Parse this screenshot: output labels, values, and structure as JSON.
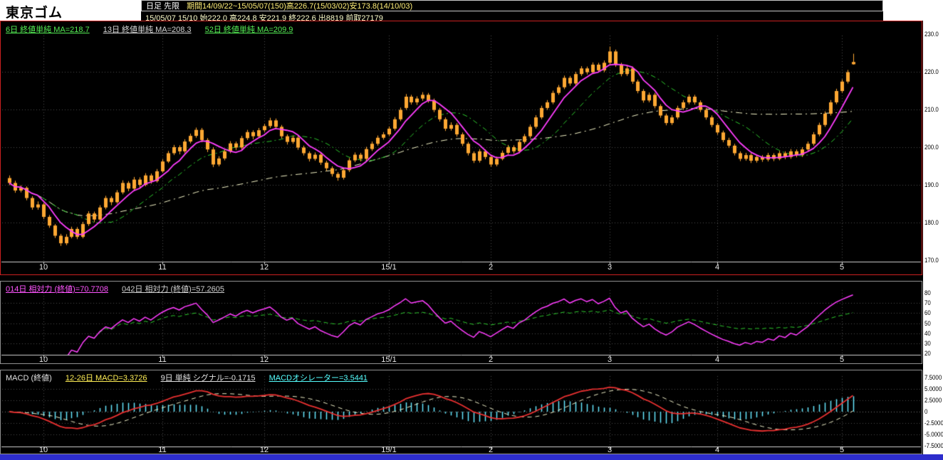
{
  "header": {
    "title": "東京ゴム",
    "chart_type": "日足 先限",
    "period_info": "期間14/09/22~15/05/07(150)高226.7(15/03/02)安173.8(14/10/03)",
    "quote_line": "15/05/07 15/10 始222.0 高224.8 安221.9 終222.6 出8819 前取27179"
  },
  "main_panel": {
    "legend_ma6": "6日 終値単純 MA=218.7",
    "legend_ma13": "13日 終値単純 MA=208.3",
    "legend_ma52": "52日 終値単純 MA=209.9"
  },
  "rsi_panel": {
    "legend_rsi14": "014日 相対力 (終値)=70.7708",
    "legend_rsi42": "042日 相対力 (終値)=57.2605"
  },
  "macd_panel": {
    "legend_title": "MACD (終値)",
    "legend_macd": "12-26日 MACD=3.3726",
    "legend_signal": "9日 単純 シグナル=-0.1715",
    "legend_osc": "MACDオシレーター=3.5441"
  },
  "colors": {
    "background": "#000000",
    "candle": "#ffa833",
    "ma6": "#ff3dff",
    "ma13": "#2ecc2e",
    "ma52": "#f5f5c8",
    "rsi14": "#ff3dff",
    "rsi42": "#2ecc2e",
    "macd": "#e83030",
    "signal": "#f0f0c8",
    "oscillator": "#66e8ff",
    "grid": "#4d4d4d",
    "grid_bright": "#787878",
    "axis": "#d0d0d0",
    "frame_red": "#cc2020",
    "panel_border": "#909090",
    "bottom_bar": "#2d2dcc",
    "scale_bg": "#ffffff"
  },
  "chart_data": [
    {
      "type": "candlestick",
      "title": "東京ゴム 日足 先限",
      "ylim": [
        170,
        230
      ],
      "yticks": [
        "230.0",
        "220.0",
        "210.0",
        "200.0",
        "190.0",
        "180.0",
        "170.0"
      ],
      "months": {
        "labels": [
          "10",
          "11",
          "12",
          "15/1",
          "2",
          "3",
          "4",
          "5"
        ],
        "bar_indices": [
          6,
          27,
          45,
          67,
          85,
          106,
          125,
          147
        ]
      },
      "overlay_periods": [
        6,
        13,
        52
      ],
      "ohlc": [
        [
          191.8,
          192.5,
          189.9,
          190.5
        ],
        [
          190.5,
          191.1,
          187.9,
          188.5
        ],
        [
          188.5,
          189.9,
          188.0,
          189.2
        ],
        [
          189.2,
          189.6,
          185.9,
          186.5
        ],
        [
          186.5,
          187.0,
          183.4,
          184.0
        ],
        [
          184.0,
          185.6,
          183.4,
          184.8
        ],
        [
          184.8,
          185.2,
          180.9,
          181.5
        ],
        [
          181.5,
          182.0,
          178.6,
          179.2
        ],
        [
          179.2,
          179.6,
          175.9,
          176.5
        ],
        [
          176.5,
          177.0,
          173.8,
          174.5
        ],
        [
          174.5,
          176.9,
          174.0,
          176.2
        ],
        [
          176.2,
          178.9,
          175.8,
          178.3
        ],
        [
          178.3,
          178.8,
          175.6,
          176.2
        ],
        [
          176.2,
          180.2,
          175.8,
          179.6
        ],
        [
          179.6,
          183.0,
          179.1,
          182.4
        ],
        [
          182.4,
          182.9,
          180.1,
          180.8
        ],
        [
          180.8,
          184.6,
          180.3,
          184.0
        ],
        [
          184.0,
          187.1,
          183.5,
          186.5
        ],
        [
          186.5,
          187.0,
          184.6,
          185.4
        ],
        [
          185.4,
          188.6,
          185.0,
          188.0
        ],
        [
          188.0,
          191.2,
          187.5,
          190.5
        ],
        [
          190.5,
          191.0,
          188.3,
          189.0
        ],
        [
          189.0,
          192.1,
          188.5,
          191.4
        ],
        [
          191.4,
          192.0,
          189.2,
          190.0
        ],
        [
          190.0,
          193.1,
          189.6,
          192.5
        ],
        [
          192.5,
          193.0,
          190.3,
          191.0
        ],
        [
          191.0,
          194.2,
          190.6,
          193.6
        ],
        [
          193.6,
          196.8,
          193.2,
          196.2
        ],
        [
          196.2,
          199.0,
          195.8,
          198.4
        ],
        [
          198.4,
          200.6,
          197.9,
          200.0
        ],
        [
          200.0,
          200.5,
          198.1,
          198.9
        ],
        [
          198.9,
          202.1,
          198.4,
          201.5
        ],
        [
          201.5,
          203.6,
          201.0,
          203.0
        ],
        [
          203.0,
          205.2,
          202.5,
          204.6
        ],
        [
          204.6,
          205.1,
          201.3,
          201.9
        ],
        [
          201.9,
          202.4,
          198.7,
          199.4
        ],
        [
          199.4,
          200.0,
          194.7,
          195.4
        ],
        [
          195.4,
          197.6,
          194.9,
          197.0
        ],
        [
          197.0,
          199.5,
          196.5,
          198.9
        ],
        [
          198.9,
          201.6,
          198.4,
          201.0
        ],
        [
          201.0,
          201.5,
          199.2,
          199.9
        ],
        [
          199.9,
          203.0,
          199.4,
          202.4
        ],
        [
          202.4,
          204.6,
          201.9,
          204.0
        ],
        [
          204.0,
          204.5,
          202.1,
          202.9
        ],
        [
          202.9,
          205.1,
          202.5,
          204.5
        ],
        [
          204.5,
          206.2,
          204.0,
          205.6
        ],
        [
          205.6,
          207.8,
          205.1,
          207.1
        ],
        [
          207.1,
          207.6,
          204.8,
          205.4
        ],
        [
          205.4,
          205.9,
          202.3,
          202.9
        ],
        [
          202.9,
          203.4,
          200.7,
          201.4
        ],
        [
          201.4,
          203.1,
          200.9,
          202.5
        ],
        [
          202.5,
          203.0,
          199.3,
          199.9
        ],
        [
          199.9,
          200.4,
          197.8,
          198.4
        ],
        [
          198.4,
          198.9,
          196.2,
          196.9
        ],
        [
          196.9,
          198.6,
          196.4,
          198.0
        ],
        [
          198.0,
          198.5,
          195.3,
          195.9
        ],
        [
          195.9,
          196.4,
          193.7,
          194.4
        ],
        [
          194.4,
          194.9,
          192.2,
          192.9
        ],
        [
          192.9,
          193.4,
          191.1,
          191.9
        ],
        [
          191.9,
          194.5,
          191.4,
          193.9
        ],
        [
          193.9,
          197.1,
          193.4,
          196.5
        ],
        [
          196.5,
          198.6,
          196.0,
          198.0
        ],
        [
          198.0,
          198.5,
          196.2,
          196.9
        ],
        [
          196.9,
          200.1,
          196.4,
          199.5
        ],
        [
          199.5,
          201.5,
          199.0,
          200.9
        ],
        [
          200.9,
          203.1,
          200.4,
          202.5
        ],
        [
          202.5,
          204.0,
          202.0,
          203.4
        ],
        [
          203.4,
          205.5,
          202.9,
          204.9
        ],
        [
          204.9,
          208.0,
          204.4,
          207.4
        ],
        [
          207.4,
          210.5,
          206.9,
          209.9
        ],
        [
          210.4,
          214.1,
          209.9,
          213.4
        ],
        [
          213.4,
          213.9,
          211.3,
          211.9
        ],
        [
          211.9,
          213.5,
          211.2,
          212.9
        ],
        [
          212.9,
          214.6,
          212.3,
          213.9
        ],
        [
          213.9,
          214.4,
          211.8,
          212.4
        ],
        [
          212.4,
          212.9,
          209.3,
          209.9
        ],
        [
          209.9,
          210.4,
          206.8,
          207.4
        ],
        [
          207.4,
          207.9,
          204.3,
          204.9
        ],
        [
          204.9,
          206.6,
          204.4,
          205.9
        ],
        [
          205.9,
          206.4,
          202.8,
          203.4
        ],
        [
          203.4,
          203.9,
          200.3,
          200.9
        ],
        [
          200.9,
          201.4,
          197.8,
          198.4
        ],
        [
          198.4,
          198.9,
          195.8,
          196.4
        ],
        [
          196.4,
          199.5,
          195.9,
          198.9
        ],
        [
          198.9,
          199.4,
          196.8,
          197.4
        ],
        [
          197.4,
          197.9,
          194.8,
          195.4
        ],
        [
          195.4,
          197.5,
          194.9,
          196.9
        ],
        [
          196.9,
          199.1,
          196.5,
          198.5
        ],
        [
          198.5,
          200.6,
          198.0,
          200.0
        ],
        [
          200.0,
          200.5,
          198.3,
          198.9
        ],
        [
          198.9,
          202.0,
          198.4,
          201.4
        ],
        [
          201.4,
          203.5,
          200.9,
          202.9
        ],
        [
          202.9,
          206.0,
          202.4,
          205.4
        ],
        [
          205.4,
          208.5,
          204.9,
          207.9
        ],
        [
          207.9,
          211.0,
          207.4,
          210.4
        ],
        [
          210.4,
          212.5,
          209.9,
          211.9
        ],
        [
          211.9,
          215.0,
          211.4,
          214.4
        ],
        [
          214.4,
          216.5,
          213.9,
          215.9
        ],
        [
          215.9,
          219.0,
          215.4,
          218.4
        ],
        [
          218.4,
          218.9,
          216.3,
          216.9
        ],
        [
          216.9,
          220.0,
          216.4,
          219.4
        ],
        [
          219.4,
          221.5,
          218.9,
          220.9
        ],
        [
          220.9,
          221.4,
          219.3,
          219.9
        ],
        [
          219.9,
          222.5,
          219.4,
          221.9
        ],
        [
          221.9,
          222.4,
          219.8,
          220.4
        ],
        [
          220.4,
          223.0,
          219.9,
          222.4
        ],
        [
          222.4,
          226.7,
          221.9,
          225.4
        ],
        [
          225.4,
          225.9,
          221.3,
          221.9
        ],
        [
          221.9,
          222.4,
          218.8,
          219.4
        ],
        [
          219.4,
          221.5,
          218.9,
          220.9
        ],
        [
          220.9,
          221.4,
          216.8,
          217.4
        ],
        [
          217.4,
          217.9,
          214.3,
          214.9
        ],
        [
          214.9,
          215.4,
          211.8,
          212.4
        ],
        [
          212.4,
          214.5,
          211.9,
          213.9
        ],
        [
          213.9,
          214.4,
          210.3,
          210.9
        ],
        [
          210.9,
          211.4,
          207.8,
          208.4
        ],
        [
          208.4,
          208.9,
          205.8,
          206.4
        ],
        [
          206.4,
          208.5,
          205.9,
          207.9
        ],
        [
          207.9,
          211.0,
          207.4,
          210.4
        ],
        [
          210.4,
          212.5,
          209.9,
          211.9
        ],
        [
          211.9,
          214.0,
          211.4,
          213.4
        ],
        [
          213.4,
          213.9,
          211.3,
          211.9
        ],
        [
          211.9,
          212.4,
          209.3,
          209.9
        ],
        [
          209.9,
          210.4,
          207.3,
          207.9
        ],
        [
          207.9,
          208.4,
          205.3,
          205.9
        ],
        [
          205.9,
          206.4,
          203.3,
          203.9
        ],
        [
          203.9,
          204.4,
          201.3,
          201.9
        ],
        [
          201.9,
          202.5,
          199.8,
          200.4
        ],
        [
          200.4,
          200.9,
          197.8,
          198.4
        ],
        [
          198.4,
          198.9,
          196.3,
          196.9
        ],
        [
          196.9,
          198.5,
          196.4,
          197.9
        ],
        [
          197.9,
          198.4,
          195.8,
          196.4
        ],
        [
          196.4,
          198.0,
          195.9,
          197.4
        ],
        [
          197.4,
          197.9,
          196.1,
          196.7
        ],
        [
          196.7,
          198.5,
          196.2,
          197.9
        ],
        [
          197.9,
          198.4,
          196.3,
          196.9
        ],
        [
          196.9,
          199.0,
          196.5,
          198.4
        ],
        [
          198.4,
          198.9,
          196.8,
          197.4
        ],
        [
          197.4,
          199.5,
          196.9,
          198.9
        ],
        [
          198.9,
          199.4,
          197.3,
          197.9
        ],
        [
          197.9,
          200.0,
          197.4,
          199.4
        ],
        [
          199.4,
          201.5,
          198.9,
          200.9
        ],
        [
          200.9,
          204.0,
          200.4,
          203.4
        ],
        [
          203.4,
          206.5,
          202.9,
          205.9
        ],
        [
          205.9,
          209.5,
          205.4,
          208.9
        ],
        [
          208.9,
          212.5,
          208.4,
          211.9
        ],
        [
          211.9,
          215.5,
          211.4,
          214.9
        ],
        [
          214.9,
          218.0,
          214.4,
          217.4
        ],
        [
          217.4,
          220.5,
          216.9,
          219.9
        ],
        [
          222.0,
          224.8,
          221.9,
          222.6
        ]
      ]
    },
    {
      "type": "line",
      "indicator": "相対力 (RSI)",
      "periods": [
        14,
        42
      ],
      "ylim": [
        20,
        80
      ],
      "yticks": [
        "80",
        "70",
        "60",
        "50",
        "40",
        "30",
        "20"
      ],
      "last_values": {
        "rsi14": 70.7708,
        "rsi42": 57.2605
      }
    },
    {
      "type": "macd",
      "fast": 12,
      "slow": 26,
      "signal_period": 9,
      "signal_type": "単純",
      "ylim": [
        -7.5,
        7.5
      ],
      "yticks": [
        "7.5000",
        "5.0000",
        "2.5000",
        "0",
        "-2.5000",
        "-5.0000",
        "-7.5000"
      ],
      "last_values": {
        "macd": 3.3726,
        "signal": -0.1715,
        "oscillator": 3.5441
      }
    }
  ]
}
